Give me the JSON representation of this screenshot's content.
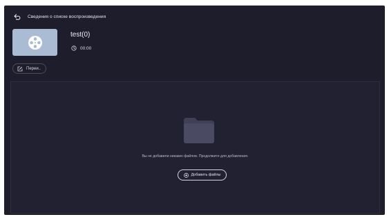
{
  "header": {
    "title": "Сведения о списке воспроизведения"
  },
  "playlist": {
    "name": "test(0)",
    "duration": "00:00"
  },
  "toolbar": {
    "rename_label": "Переи.."
  },
  "dropzone": {
    "empty_message": "Вы не добавили никаких файлов. Продолжите для добавления.",
    "add_button_label": "Добавить файлы"
  },
  "icons": {
    "back": "back-arrow-icon",
    "thumbnail": "film-reel-icon",
    "duration": "clock-icon",
    "rename": "edit-icon",
    "empty": "folder-icon",
    "add": "plus-circle-icon"
  },
  "colors": {
    "background": "#1d1d2c",
    "panel": "#212132",
    "thumbnail": "#a9bcd4",
    "folder": "#4a4a62"
  }
}
